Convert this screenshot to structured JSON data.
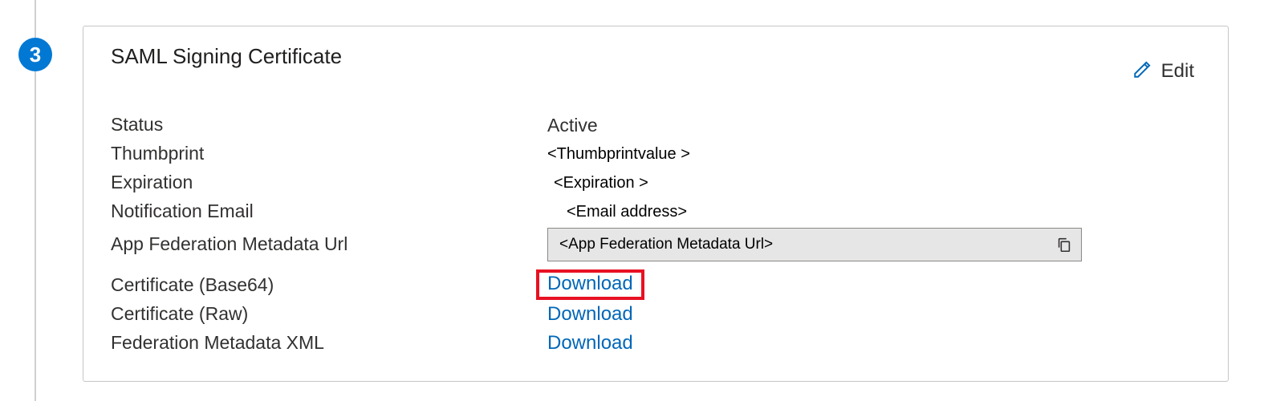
{
  "step": {
    "number": "3"
  },
  "card": {
    "title": "SAML Signing Certificate",
    "edit_label": "Edit"
  },
  "fields": {
    "status": {
      "label": "Status",
      "value": "Active"
    },
    "thumbprint": {
      "label": "Thumbprint",
      "value": "<Thumbprintvalue >"
    },
    "expiration": {
      "label": "Expiration",
      "value": "<Expiration >"
    },
    "notification_email": {
      "label": "Notification Email",
      "value": "<Email address>"
    },
    "metadata_url": {
      "label": "App Federation Metadata Url",
      "value": "<App Federation  Metadata Url>"
    },
    "cert_b64": {
      "label": "Certificate (Base64)",
      "link": "Download"
    },
    "cert_raw": {
      "label": "Certificate (Raw)",
      "link": "Download"
    },
    "fed_xml": {
      "label": "Federation Metadata XML",
      "link": "Download"
    }
  }
}
